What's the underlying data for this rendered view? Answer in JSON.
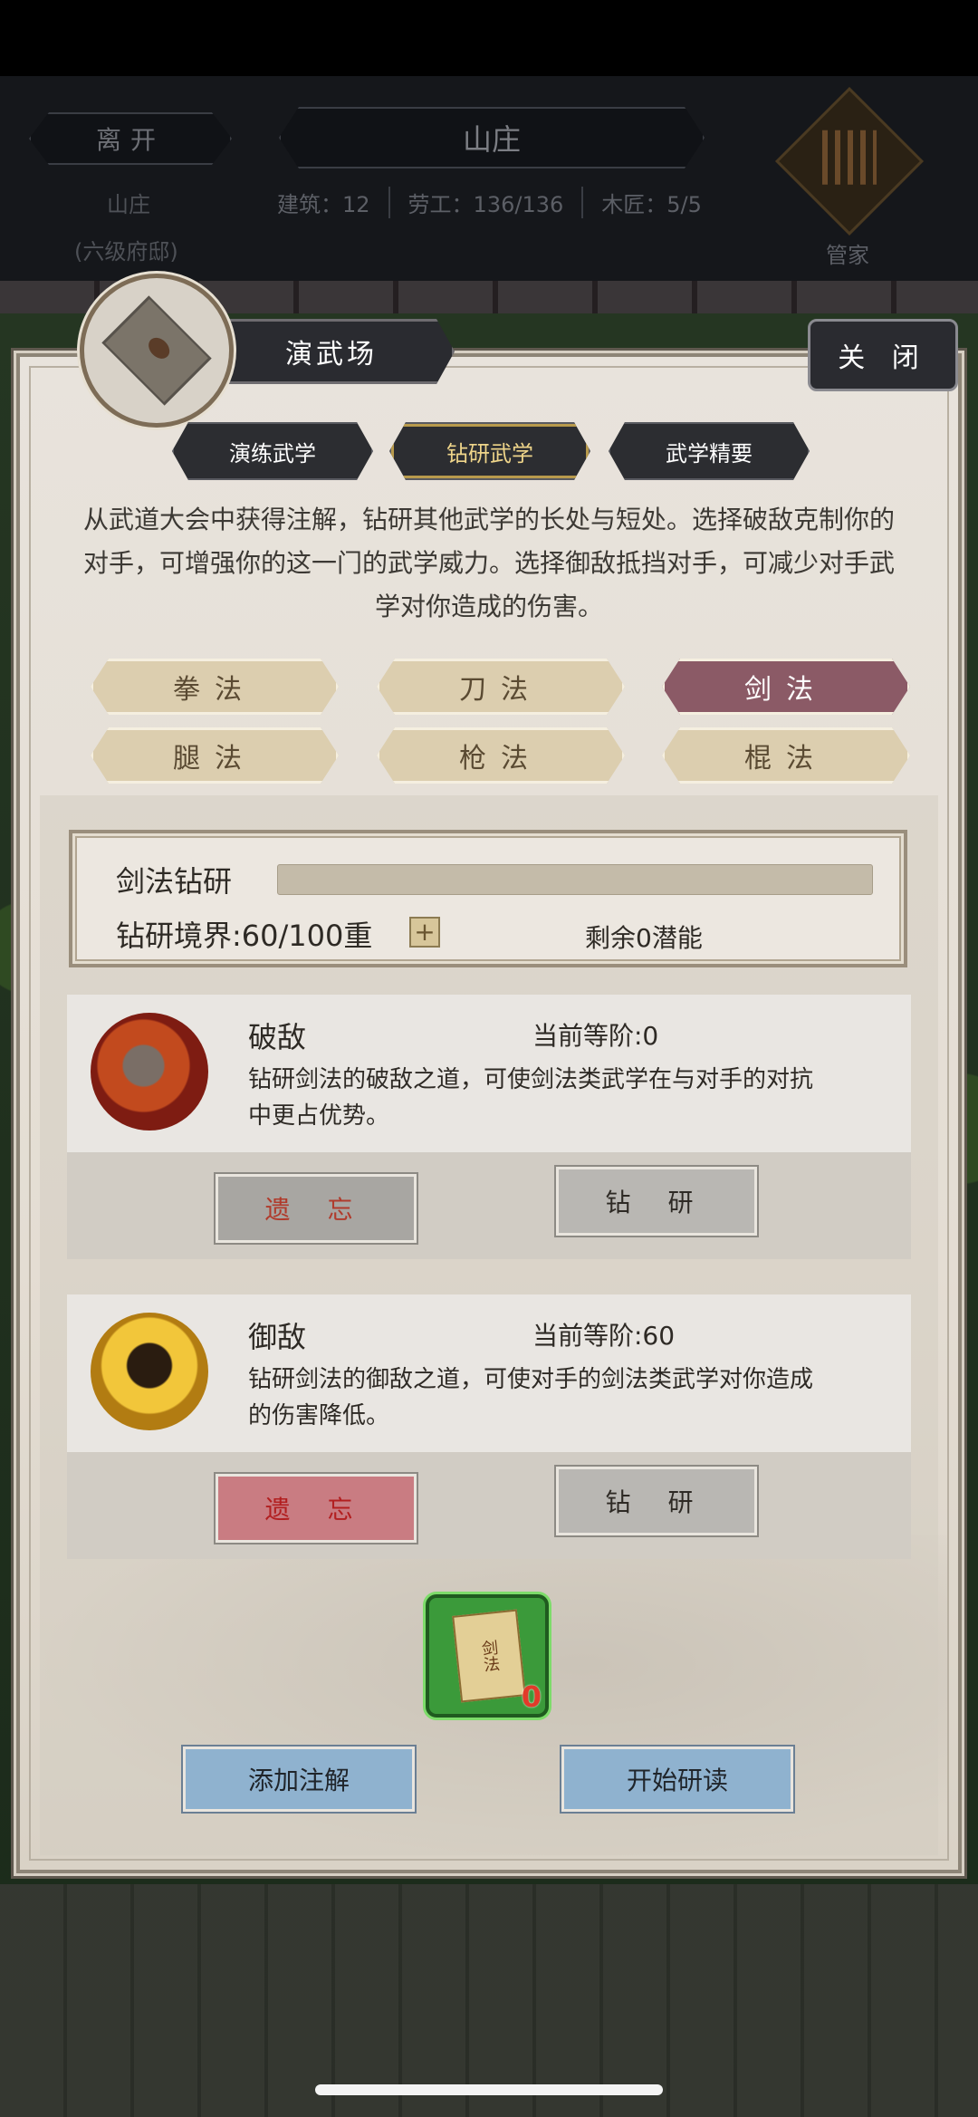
{
  "topbar": {
    "leave_label": "离开",
    "title": "山庄",
    "left_label": "山庄",
    "left_sublabel": "(六级府邸)",
    "stats": [
      "建筑：12",
      "劳工：136/136",
      "木匠：5/5"
    ],
    "steward_label": "管家"
  },
  "panel": {
    "title": "演武场",
    "close_label": "关 闭",
    "tabs": [
      {
        "label": "演练武学",
        "active": false
      },
      {
        "label": "钻研武学",
        "active": true
      },
      {
        "label": "武学精要",
        "active": false
      }
    ],
    "description": "从武道大会中获得注解，钻研其他武学的长处与短处。选择破敌克制你的对手，可增强你的这一门的武学威力。选择御敌抵挡对手，可减少对手武学对你造成的伤害。",
    "categories": [
      {
        "label": "拳法",
        "active": false
      },
      {
        "label": "刀法",
        "active": false
      },
      {
        "label": "剑法",
        "active": true
      },
      {
        "label": "腿法",
        "active": false
      },
      {
        "label": "枪法",
        "active": false
      },
      {
        "label": "棍法",
        "active": false
      }
    ]
  },
  "study": {
    "label": "剑法钻研",
    "progress": 0,
    "realm_text": "钻研境界:60/100重",
    "plus_label": "+",
    "remaining_text": "剩余0潜能"
  },
  "skills": [
    {
      "name": "破敌",
      "level_text": "当前等阶:0",
      "desc": "钻研剑法的破敌之道，可使剑法类武学在与对手的对抗中更占优势。",
      "forget_label": "遗 忘",
      "research_label": "钻 研",
      "icon": "spiked-mace-icon"
    },
    {
      "name": "御敌",
      "level_text": "当前等阶:60",
      "desc": "钻研剑法的御敌之道，可使对手的剑法类武学对你造成的伤害降低。",
      "forget_label": "遗 忘",
      "research_label": "钻 研",
      "icon": "warrior-guard-icon"
    }
  ],
  "item": {
    "label": "剑法",
    "count": "0",
    "icon": "sword-manual-icon"
  },
  "actions": {
    "add_label": "添加注解",
    "start_label": "开始研读"
  },
  "colors": {
    "active_category": "#8b5a66",
    "action_button": "#8fb2cf",
    "forget_enabled": "#c97c82",
    "item_frame": "#3b9a3a"
  }
}
